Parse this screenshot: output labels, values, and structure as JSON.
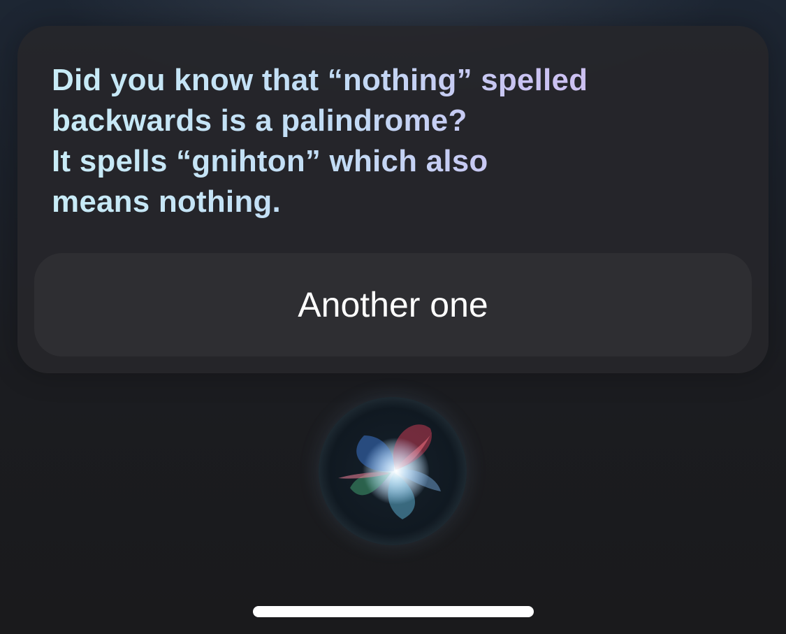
{
  "siri_response": {
    "lines": [
      "Did you know that “nothing” spelled",
      "backwards is a palindrome?",
      "It spells “gnihton” which also",
      "means nothing."
    ]
  },
  "action_button": {
    "label": "Another one"
  },
  "siri_orb": {
    "icon": "siri-orb-icon"
  },
  "colors": {
    "text_gradient_start": "#c8ecf7",
    "text_gradient_end": "#d2bdf0",
    "card_background": "#26262a",
    "button_background": "#2e2e32",
    "button_text": "#ffffff"
  }
}
